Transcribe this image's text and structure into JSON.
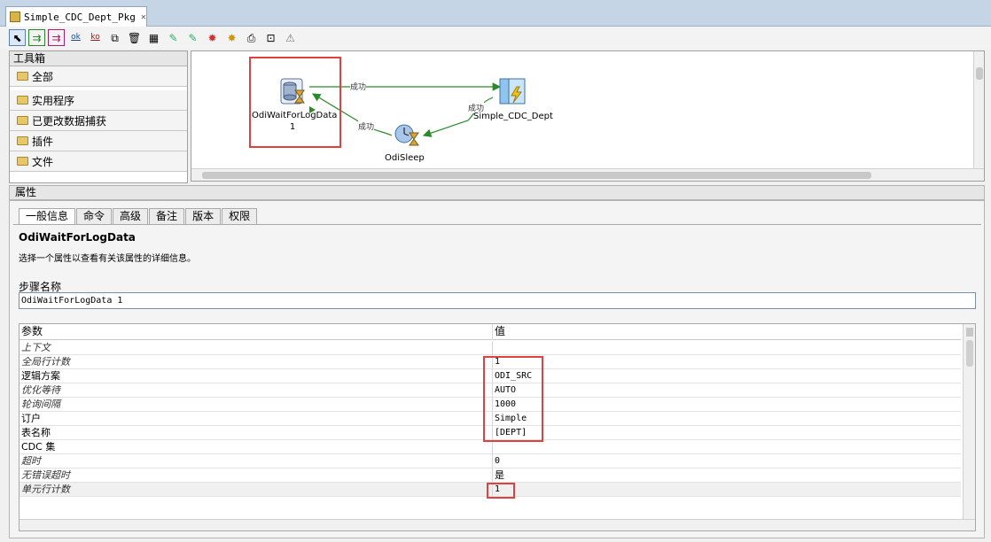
{
  "window": {
    "tab_title": "Simple_CDC_Dept_Pkg"
  },
  "toolbar": {
    "ok_label": "ok",
    "ko_label": "ko"
  },
  "toolbox": {
    "title": "工具箱",
    "items": [
      {
        "label": "全部"
      },
      {
        "label": "实用程序"
      },
      {
        "label": "已更改数据捕获"
      },
      {
        "label": "插件"
      },
      {
        "label": "文件"
      }
    ]
  },
  "diagram": {
    "nodes": [
      {
        "label": "OdiWaitForLogData",
        "sublabel": "1",
        "icon": "database-hourglass-icon"
      },
      {
        "label": "Simple_CDC_Dept",
        "icon": "package-lightning-icon"
      },
      {
        "label": "OdiSleep",
        "icon": "clock-hourglass-icon"
      }
    ],
    "links": [
      {
        "label": "成功",
        "from": "OdiWaitForLogData",
        "to": "Simple_CDC_Dept"
      },
      {
        "label": "成功",
        "from": "Simple_CDC_Dept",
        "to": "OdiSleep"
      },
      {
        "label": "成功",
        "from": "OdiSleep",
        "to": "OdiWaitForLogData"
      }
    ]
  },
  "properties": {
    "header": "属性",
    "tabs": [
      "一般信息",
      "命令",
      "高级",
      "备注",
      "版本",
      "权限"
    ],
    "active_tab": "一般信息",
    "title": "OdiWaitForLogData",
    "description": "选择一个属性以查看有关该属性的详细信息。",
    "step_name_label": "步骤名称",
    "step_name_value": "OdiWaitForLogData 1",
    "table": {
      "col_param": "参数",
      "col_value": "值",
      "rows": [
        {
          "param": "上下文",
          "value": "",
          "italic": true
        },
        {
          "param": "全局行计数",
          "value": "1",
          "italic": true
        },
        {
          "param": "逻辑方案",
          "value": "ODI_SRC",
          "italic": false
        },
        {
          "param": "优化等待",
          "value": "AUTO",
          "italic": true
        },
        {
          "param": "轮询间隔",
          "value": "1000",
          "italic": true
        },
        {
          "param": "订户",
          "value": "Simple",
          "italic": false
        },
        {
          "param": "表名称",
          "value": "[DEPT]",
          "italic": false
        },
        {
          "param": "CDC 集",
          "value": "",
          "italic": false
        },
        {
          "param": "超时",
          "value": "0",
          "italic": true
        },
        {
          "param": "无错误超时",
          "value": "是",
          "italic": true
        },
        {
          "param": "单元行计数",
          "value": "1",
          "italic": true
        }
      ]
    }
  },
  "colors": {
    "highlight": "#e04040",
    "link": "#2a8a2a",
    "chrome": "#c6d5e6"
  }
}
